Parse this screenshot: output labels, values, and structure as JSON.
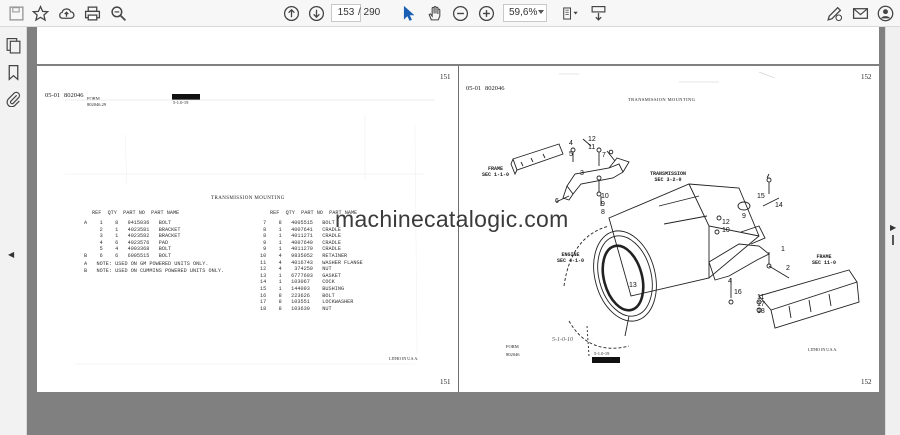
{
  "toolbar": {
    "page_current": "153",
    "page_total": "/ 290",
    "zoom": "59,6%"
  },
  "watermark": "machinecatalogic.com",
  "left_page": {
    "page_no_top": "151",
    "page_no_bottom": "151",
    "ref_code": "05-01",
    "book_no": "802046",
    "form_label": "FORM",
    "form_no": "802046.29",
    "stamp": "5-1.0-19",
    "section_title": "TRANSMISSION MOUNTING",
    "litho": "LITHO IN U.S.A.",
    "table_left_header": "REF  QTY  PART NO  PART NAME",
    "table_left_rows": [
      "A    1    8   9415036   BOLT",
      "     2    1   4023581   BRACKET",
      "     3    1   4023582   BRACKET",
      "     4    6   4023576   PAD",
      "     5    4   4003368   BOLT",
      "B    6    6   6005515   BOLT"
    ],
    "table_right_header": "REF  QTY  PART NO  PART NAME",
    "table_right_rows": [
      " 7    8   4005515   BOLT",
      " 8    1   4007641   CRADLE",
      " 8    1   4011271   CRADLE",
      " 9    1   4007640   CRADLE",
      " 9    1   4011270   CRADLE",
      "10    4   9835052   RETAINER",
      "11    4   4016743   WASHER FLANGE",
      "12    4    374250   NUT",
      "13    1   6777693   GASKET",
      "14    1   103067    COCK",
      "15    1   144093    BUSHING",
      "16    8   223626    BOLT",
      "17    8   103551    LOCKWASHER",
      "18    8   103639    NUT"
    ],
    "notes": [
      "A   NOTE: USED ON GM POWERED UNITS ONLY.",
      "B   NOTE: USED ON CUMMINS POWERED UNITS ONLY."
    ]
  },
  "right_page": {
    "page_no_top": "152",
    "page_no_bottom": "152",
    "ref_code": "05-01",
    "book_no": "802046",
    "section_title": "TRANSMISSION MOUNTING",
    "form_label": "FORM",
    "form_no": "802046",
    "stamp": "5-1.0-19",
    "handwritten": "5-1-0-10",
    "litho": "LITHO IN U.S.A.",
    "labels": {
      "frame_left": "FRAME\nSEC 1-1-0",
      "transmission": "TRANSMISSION\nSEC 3-2-0",
      "engine": "ENGINE\nSEC 4-1-0",
      "frame_right": "FRAME\nSEC 11-0"
    },
    "callouts": [
      "4",
      "5",
      "12",
      "11",
      "7",
      "3",
      "10",
      "9",
      "8",
      "6",
      "13",
      "15",
      "14",
      "9",
      "12",
      "10",
      "1",
      "4",
      "2",
      "16",
      "11",
      "17",
      "18"
    ]
  }
}
